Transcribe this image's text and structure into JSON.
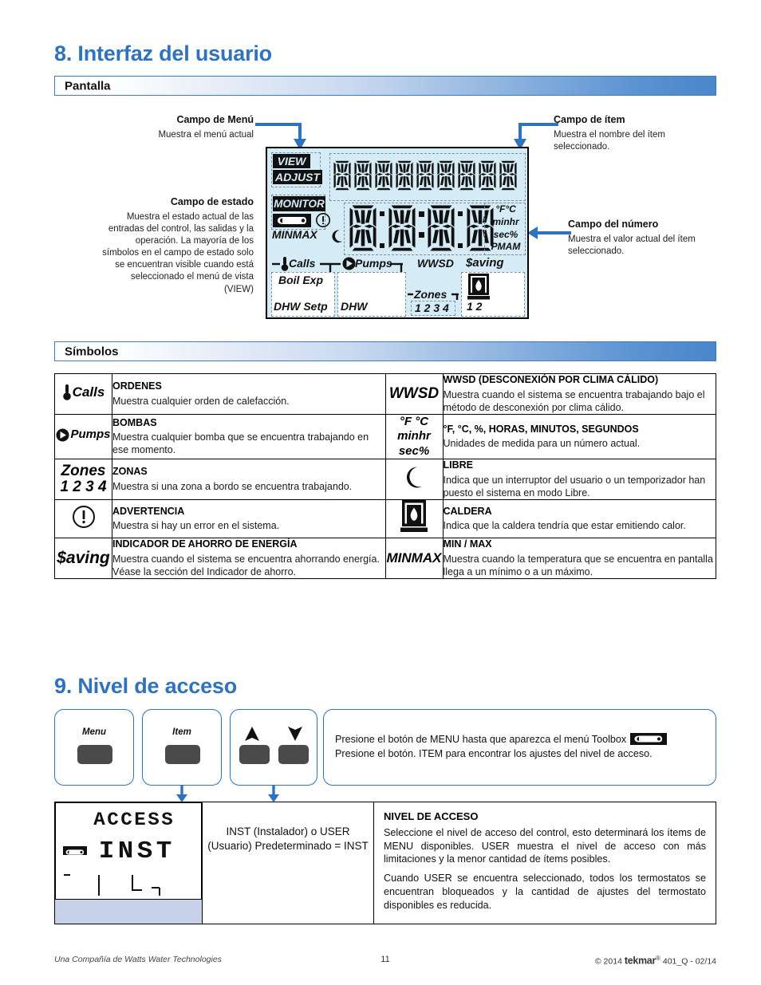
{
  "sections": {
    "s8_title": "8. Interfaz del usuario",
    "s8_bar": "Pantalla",
    "symbols_bar": "Símbolos",
    "s9_title": "9. Nivel de acceso"
  },
  "callouts": {
    "menu_field": {
      "heading": "Campo de Menú",
      "body": "Muestra el menú actual"
    },
    "status_field": {
      "heading": "Campo de estado",
      "body": "Muestra el estado actual de las entradas del control, las salidas y la operación. La mayoría de los símbolos en el campo de estado solo se encuentran visible cuando está seleccionado el menú de vista (VIEW)"
    },
    "item_field": {
      "heading": "Campo de ítem",
      "body": "Muestra el nombre del ítem seleccionado."
    },
    "number_field": {
      "heading": "Campo del número",
      "body": "Muestra el valor actual del ítem seleccionado."
    }
  },
  "lcd": {
    "view": "VIEW",
    "adjust": "ADJUST",
    "monitor": "MONITOR",
    "minmax": "MINMAX",
    "units": [
      "°F°C",
      "minhr",
      "sec%",
      "PMAM"
    ],
    "calls": "Calls",
    "pumps": "Pumps",
    "wwsd": "WWSD",
    "saving": "$aving",
    "boil_exp": "Boil Exp",
    "dhw_setp": "DHW Setp",
    "dhw": "DHW",
    "zones": "Zones",
    "zone_numbers": "1 2 3 4",
    "boiler_numbers": "1 2",
    "item_char_count": 9,
    "number_char_count": 4
  },
  "symbols_table": {
    "rows": [
      {
        "left": {
          "icon": "calls-thermometer-icon",
          "icon_text": "Calls",
          "title": "ORDENES",
          "desc": "Muestra cualquier orden de calefacción."
        },
        "right": {
          "icon": "wwsd-icon",
          "icon_text": "WWSD",
          "title": "WWSD (DESCONEXIÓN POR CLIMA CÁLIDO)",
          "desc": "Muestra cuando el sistema se encuentra trabajando bajo el método de desconexión por clima cálido."
        }
      },
      {
        "left": {
          "icon": "pumps-icon",
          "icon_text": "Pumps",
          "title": "BOMBAS",
          "desc": "Muestra cualquier bomba que se encuentra trabajando en ese momento."
        },
        "right": {
          "icon": "units-icon",
          "icon_text": "°F °C minhr sec%",
          "title": "°F, °C, %, HORAS, MINUTOS, SEGUNDOS",
          "desc": "Unidades de medida para un número actual."
        }
      },
      {
        "left": {
          "icon": "zones-icon",
          "icon_text": "Zones 1 2 3 4",
          "title": "ZONAS",
          "desc": "Muestra si una zona a bordo se encuentra trabajando."
        },
        "right": {
          "icon": "moon-icon",
          "icon_text": "",
          "title": "LIBRE",
          "desc": "Indica que un interruptor del usuario o un temporizador han puesto el sistema en modo Libre."
        }
      },
      {
        "left": {
          "icon": "warning-icon",
          "icon_text": "",
          "title": "ADVERTENCIA",
          "desc": "Muestra si hay un error en el sistema."
        },
        "right": {
          "icon": "boiler-flame-icon",
          "icon_text": "",
          "title": "CALDERA",
          "desc": "Indica que la caldera tendría que estar emitiendo calor."
        }
      },
      {
        "left": {
          "icon": "saving-icon",
          "icon_text": "$aving",
          "title": "INDICADOR DE AHORRO DE ENERGÍA",
          "desc": "Muestra cuando el sistema se encuentra ahorrando energía. Véase la sección del Indicador de ahorro."
        },
        "right": {
          "icon": "minmax-icon",
          "icon_text": "MINMAX",
          "title": "MIN / MAX",
          "desc": "Muestra cuando la temperatura que se encuentra en pantalla llega a un mínimo o a un máximo."
        }
      }
    ]
  },
  "access_section": {
    "buttons": [
      {
        "label": "Menu",
        "name": "menu-button"
      },
      {
        "label": "Item",
        "name": "item-button"
      },
      {
        "label": "up-down",
        "name": "up-down-buttons"
      }
    ],
    "instruction_line1": "Presione el botón de MENU hasta que aparezca el menú Toolbox",
    "instruction_line2": "Presione el botón. ITEM para encontrar los ajustes del nivel de acceso.",
    "display_line1": "ACCESS",
    "display_line2": "INST",
    "middle_text": "INST (Instalador) o USER (Usuario) Predeterminado = INST",
    "title": "NIVEL DE ACCESO",
    "paragraph1": "Seleccione el nivel de acceso del control, esto determinará los ítems de MENU disponibles. USER muestra el nivel de acceso con más limitaciones y la menor cantidad de ítems posibles.",
    "paragraph2": "Cuando USER se encuentra seleccionado, todos los termostatos se encuentran bloqueados y la cantidad de ajustes del termostato disponibles es reducida."
  },
  "footer": {
    "left": "Una Compañía de Watts Water Technologies",
    "page": "11",
    "right_copyright": "© 2014",
    "right_brand": "tekmar",
    "right_reg": "®",
    "right_code": "401_Q - 02/14"
  },
  "colors": {
    "accent_blue": "#2f72bd",
    "lcd_bg": "#d5ecf7",
    "lcd2_bg": "#c7d2ea",
    "button_gray": "#4a4a4a"
  }
}
